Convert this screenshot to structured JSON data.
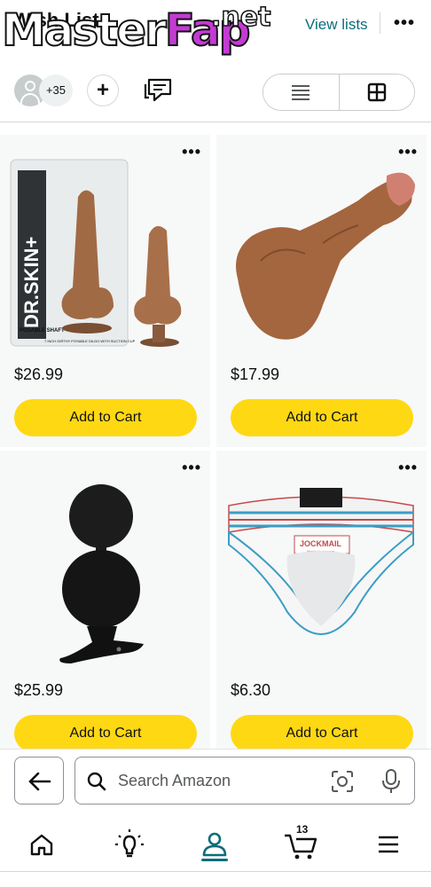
{
  "header": {
    "title": "Wish List",
    "view_lists_label": "View lists",
    "more_icon": "more-horizontal-icon",
    "watermark": {
      "master": "Master",
      "fap": "Fap",
      "net": ".net"
    }
  },
  "toolbar": {
    "member_count": "+35",
    "add_label": "+",
    "icons": [
      "person-avatar-icon",
      "plus-icon",
      "chat-icon",
      "list-view-icon",
      "grid-view-icon"
    ]
  },
  "products": [
    {
      "name": "dr-skin-dildo",
      "price": "$26.99",
      "cart_label": "Add to Cart",
      "box_text": "DR.SKIN+",
      "box_subtext": "POSABLE SHAFT",
      "box_caption": "7 INCH GIRTHY POSABLE DILDO WITH SUCTION CUP"
    },
    {
      "name": "realistic-dildo",
      "price": "$17.99",
      "cart_label": "Add to Cart"
    },
    {
      "name": "silicone-plug",
      "price": "$25.99",
      "cart_label": "Add to Cart"
    },
    {
      "name": "jockstrap",
      "price": "$6.30",
      "cart_label": "Add to Cart",
      "brand_text": "JOCKMAIL",
      "brand_subtext": "Men's Underwear"
    }
  ],
  "search": {
    "placeholder": "Search Amazon"
  },
  "bottom_nav": {
    "items": [
      "home-icon",
      "lightbulb-icon",
      "account-icon",
      "cart-icon",
      "menu-icon"
    ],
    "cart_count": "13"
  },
  "colors": {
    "accent": "#0a6d7c",
    "cart_button": "#ffd814",
    "card_bg": "#f7f8f8"
  }
}
